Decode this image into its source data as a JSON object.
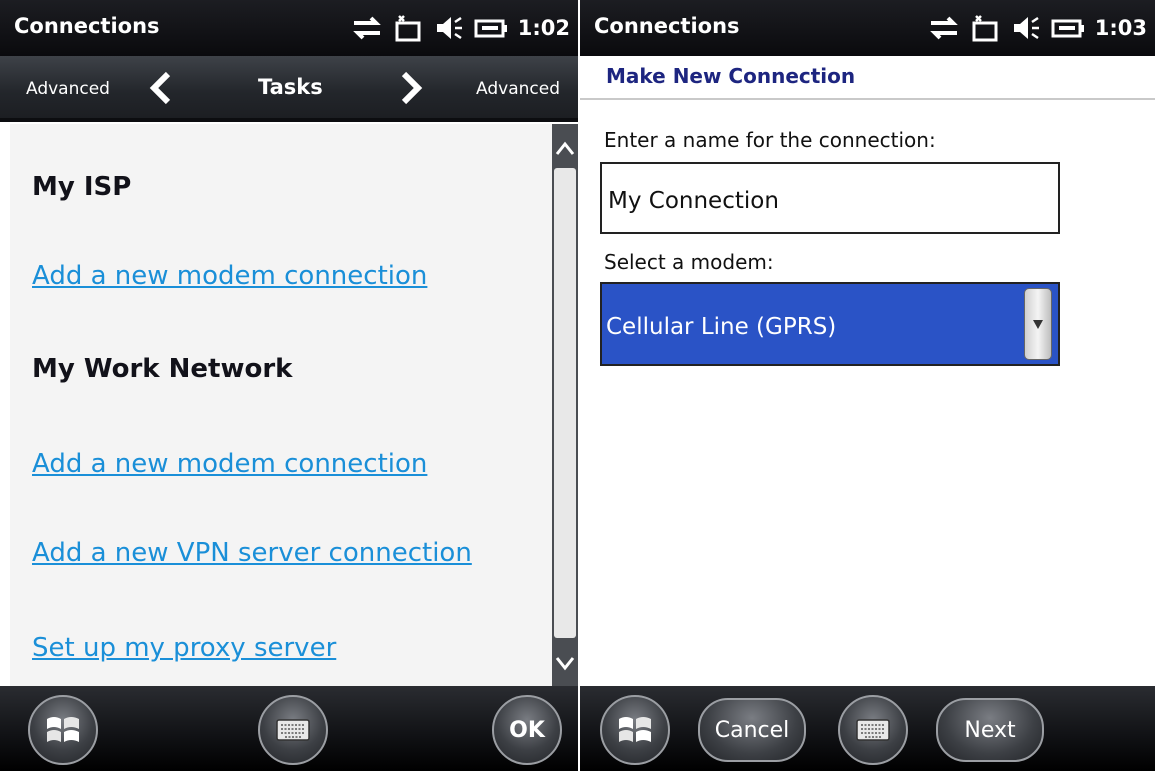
{
  "left": {
    "window_title": "Connections",
    "time": "1:02",
    "nav": {
      "left_label": "Advanced",
      "center_label": "Tasks",
      "right_label": "Advanced"
    },
    "groups": [
      {
        "heading": "My ISP",
        "links": [
          "Add a new modem connection"
        ]
      },
      {
        "heading": "My Work Network",
        "links": [
          "Add a new modem connection",
          "Add a new VPN server connection",
          "Set up my proxy server"
        ]
      }
    ],
    "softkeys": {
      "ok_label": "OK"
    }
  },
  "right": {
    "window_title": "Connections",
    "time": "1:03",
    "subheader": "Make New Connection",
    "name_label": "Enter a name for the connection:",
    "name_value": "My Connection",
    "modem_label": "Select a modem:",
    "modem_value": "Cellular Line (GPRS)",
    "softkeys": {
      "cancel_label": "Cancel",
      "next_label": "Next"
    }
  },
  "colors": {
    "link": "#1a8fd8",
    "header_text": "#1d2580",
    "selected_bg": "#2a53c6"
  },
  "icons": [
    "windows-start-icon",
    "keyboard-icon",
    "sync-icon",
    "signal-icon",
    "volume-icon",
    "battery-icon",
    "chevron-left-icon",
    "chevron-right-icon",
    "scroll-up-icon",
    "scroll-down-icon",
    "dropdown-arrow-icon"
  ]
}
